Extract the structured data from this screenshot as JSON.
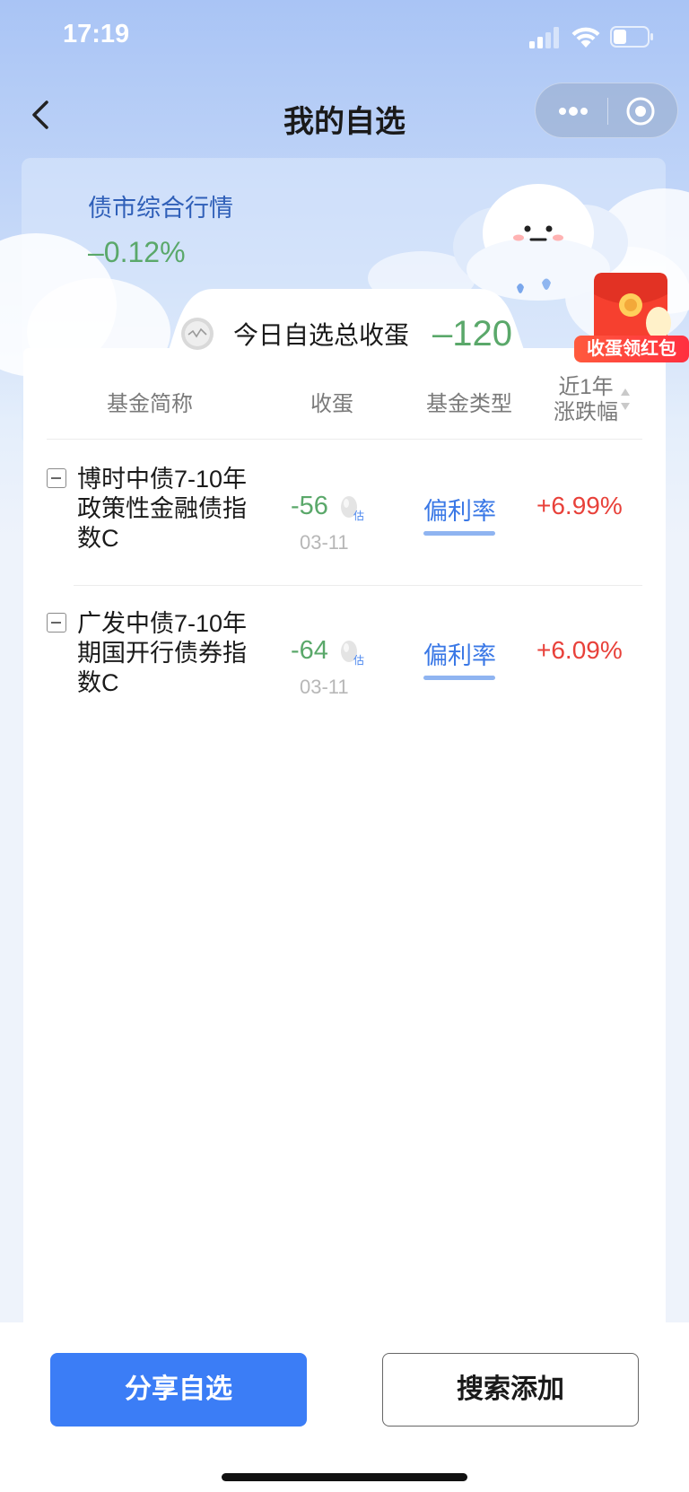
{
  "status_bar": {
    "time": "17:19"
  },
  "nav": {
    "title": "我的自选"
  },
  "market": {
    "label": "债市综合行情",
    "value": "–0.12%"
  },
  "total": {
    "label": "今日自选总收蛋",
    "value": "–120"
  },
  "promo": {
    "label": "收蛋领红包"
  },
  "table": {
    "headers": {
      "name": "基金简称",
      "eggs": "收蛋",
      "type": "基金类型",
      "change_line1": "近1年",
      "change_line2": "涨跌幅"
    },
    "rows": [
      {
        "name": "博时中债7-10年政策性金融债指数C",
        "eggs": "-56",
        "estimate": "估",
        "date": "03-11",
        "type": "偏利率",
        "change": "+6.99%"
      },
      {
        "name": "广发中债7-10年期国开行债券指数C",
        "eggs": "-64",
        "estimate": "估",
        "date": "03-11",
        "type": "偏利率",
        "change": "+6.09%"
      }
    ]
  },
  "actions": {
    "share": "分享自选",
    "search_add": "搜索添加"
  },
  "colors": {
    "accent_blue": "#3b7df6",
    "positive_green": "#5aa86a",
    "rise_red": "#e8413a",
    "type_blue": "#3a78e6"
  },
  "icons": [
    "signal-icon",
    "wifi-icon",
    "battery-icon",
    "back-arrow-icon",
    "more-icon",
    "target-icon",
    "egg-coin-icon",
    "egg-icon",
    "sort-icon",
    "minus-icon",
    "cloud-mascot",
    "red-packet-icon"
  ]
}
